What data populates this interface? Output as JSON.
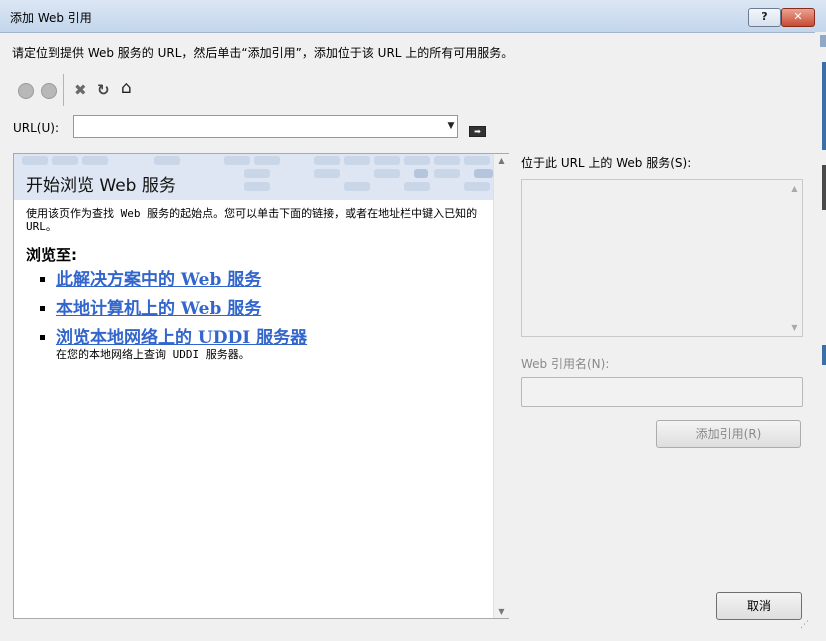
{
  "window": {
    "title": "添加 Web 引用",
    "help_label": "?",
    "close_label": "✕"
  },
  "instruction": "请定位到提供 Web 服务的 URL，然后单击“添加引用”，添加位于该 URL 上的所有可用服务。",
  "toolbar": {
    "items": [
      {
        "name": "back-icon",
        "glyph": ""
      },
      {
        "name": "forward-icon",
        "glyph": ""
      },
      {
        "name": "stop-icon",
        "glyph": "✖"
      },
      {
        "name": "refresh-icon",
        "glyph": "↻"
      },
      {
        "name": "home-icon",
        "glyph": "⌂"
      }
    ]
  },
  "url": {
    "label": "URL(U):",
    "value": "",
    "dropdown_glyph": "▼",
    "go_glyph": "➡"
  },
  "browser": {
    "banner_title": "开始浏览 Web 服务",
    "intro": "使用该页作为查找 Web 服务的起始点。您可以单击下面的链接，或者在地址栏中键入已知的 URL。",
    "browse_to": "浏览至:",
    "links": [
      {
        "label": "此解决方案中的 Web 服务",
        "desc": ""
      },
      {
        "label": "本地计算机上的 Web 服务",
        "desc": ""
      },
      {
        "label": "浏览本地网络上的 UDDI 服务器",
        "desc": "在您的本地网络上查询 UDDI 服务器。"
      }
    ],
    "colors": {
      "link": "#3366cc",
      "banner": "#dde6f2"
    }
  },
  "services": {
    "label": "位于此 URL 上的 Web 服务(S):"
  },
  "web_reference": {
    "label": "Web 引用名(N):",
    "value": ""
  },
  "buttons": {
    "add_reference": "添加引用(R)",
    "cancel": "取消"
  }
}
